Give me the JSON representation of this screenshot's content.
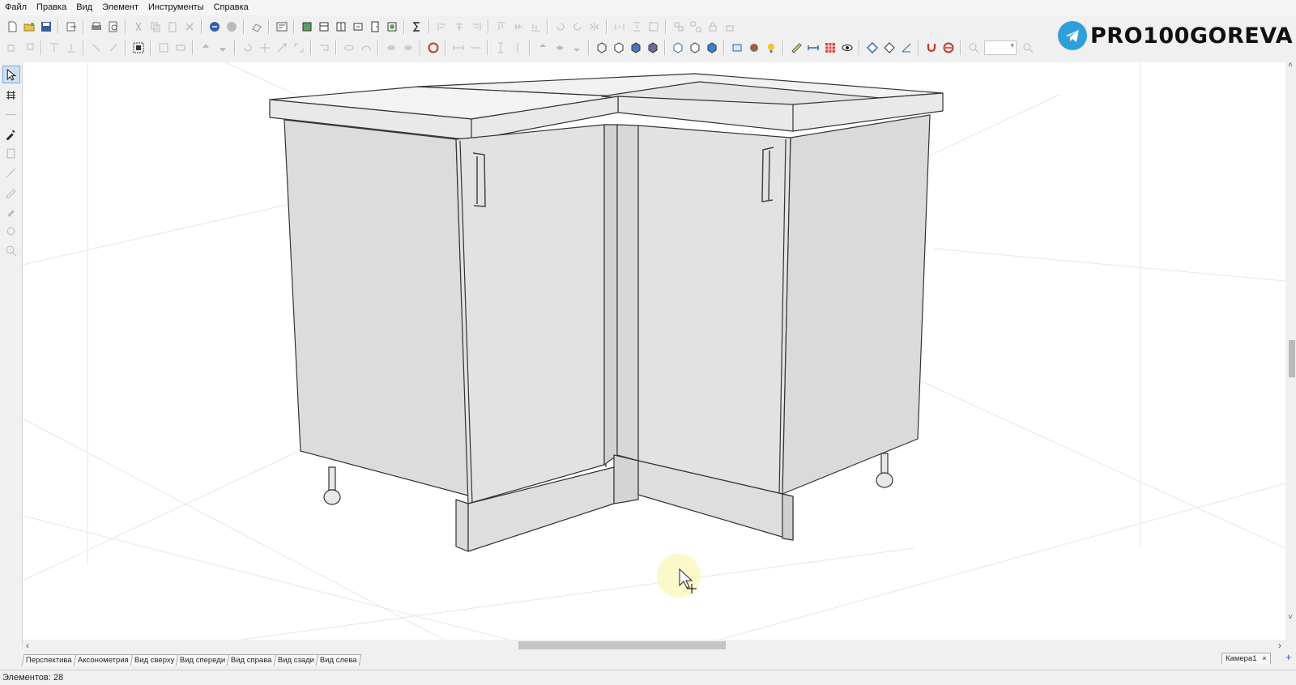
{
  "menu": [
    "Файл",
    "Правка",
    "Вид",
    "Элемент",
    "Инструменты",
    "Справка"
  ],
  "logo": {
    "text": "PRO100GOREVA",
    "icon": "telegram-icon",
    "color": "#2da0db"
  },
  "view_tabs": [
    "Перспектива",
    "Аксонометрия",
    "Вид сверху",
    "Вид спереди",
    "Вид справа",
    "Вид сзади",
    "Вид слева"
  ],
  "camera_tab": {
    "label": "Камера1",
    "close": "×"
  },
  "add_camera": "+",
  "status": {
    "text": "Элементов: 28"
  },
  "scroll": {
    "left_arrow": "‹",
    "right_arrow": "›",
    "up_arrow": "˄",
    "down_arrow": "˅"
  }
}
